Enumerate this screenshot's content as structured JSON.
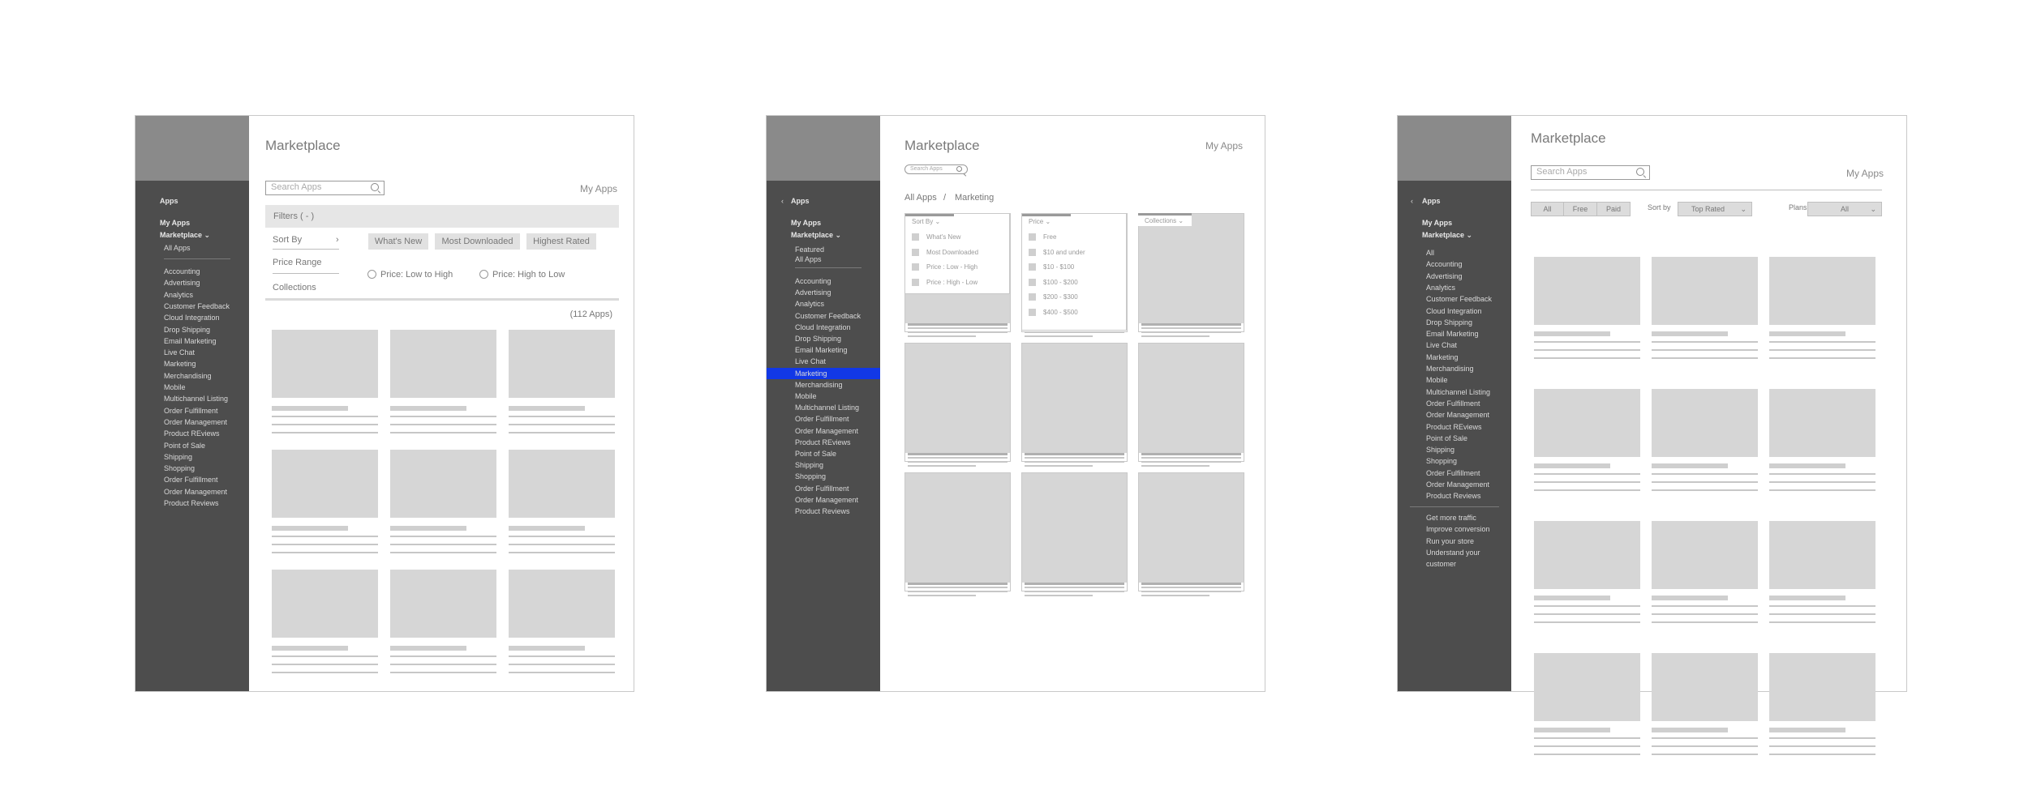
{
  "frame1": {
    "title": "Marketplace",
    "my_apps": "My Apps",
    "search_placeholder": "Search Apps",
    "filters_label": "Filters ( - )",
    "sort_by": "Sort By",
    "sort_chevron": "›",
    "price_range": "Price Range",
    "collections": "Collections",
    "chips": [
      "What's New",
      "Most Downloaded",
      "Highest Rated"
    ],
    "radios": [
      "Price: Low to High",
      "Price: High to Low"
    ],
    "count": "(112 Apps)",
    "sidebar": {
      "apps": "Apps",
      "my_apps": "My Apps",
      "marketplace": "Marketplace ⌄",
      "all_apps": "All Apps",
      "categories": [
        "Accounting",
        "Advertising",
        "Analytics",
        "Customer Feedback",
        "Cloud Integration",
        "Drop Shipping",
        "Email Marketing",
        "Live Chat",
        "Marketing",
        "Merchandising",
        "Mobile",
        "Multichannel Listing",
        "Order Fulfillment",
        "Order Management",
        "Product REviews",
        "Point of Sale",
        "Shipping",
        "Shopping",
        "Order Fulfillment",
        "Order Management",
        "Product Reviews"
      ]
    }
  },
  "frame2": {
    "title": "Marketplace",
    "my_apps": "My Apps",
    "search_placeholder": "Search Apps",
    "breadcrumb": [
      "All Apps",
      "/",
      "Marketing"
    ],
    "sort_dd": {
      "header": "Sort By  ⌄",
      "options": [
        "What's New",
        "Most Downloaded",
        "Price : Low - High",
        "Price : High - Low"
      ]
    },
    "price_dd": {
      "header": "Price  ⌄",
      "options": [
        "Free",
        "$10 and under",
        "$10 - $100",
        "$100 - $200",
        "$200 - $300",
        "$400 - $500"
      ]
    },
    "collections_dd": {
      "header": "Collections  ⌄"
    },
    "sidebar": {
      "back": "‹",
      "apps": "Apps",
      "my_apps": "My Apps",
      "marketplace": "Marketplace ⌄",
      "featured": "Featured",
      "all_apps": "All Apps",
      "categories": [
        "Accounting",
        "Advertising",
        "Analytics",
        "Customer Feedback",
        "Cloud Integration",
        "Drop Shipping",
        "Email Marketing",
        "Live Chat",
        "Marketing",
        "Merchandising",
        "Mobile",
        "Multichannel Listing",
        "Order Fulfillment",
        "Order Management",
        "Product REviews",
        "Point of Sale",
        "Shipping",
        "Shopping",
        "Order Fulfillment",
        "Order Management",
        "Product Reviews"
      ],
      "active": "Marketing"
    }
  },
  "frame3": {
    "title": "Marketplace",
    "my_apps": "My Apps",
    "search_placeholder": "Search Apps",
    "segments": [
      "All",
      "Free",
      "Paid"
    ],
    "sort_label": "Sort by",
    "sort_value": "Top Rated",
    "plans_label": "Plans",
    "plans_value": "All",
    "sidebar": {
      "back": "‹",
      "apps": "Apps",
      "my_apps": "My Apps",
      "marketplace": "Marketplace ⌄",
      "categories": [
        "All",
        "Accounting",
        "Advertising",
        "Analytics",
        "Customer Feedback",
        "Cloud Integration",
        "Drop Shipping",
        "Email Marketing",
        "Live Chat",
        "Marketing",
        "Merchandising",
        "Mobile",
        "Multichannel Listing",
        "Order Fulfillment",
        "Order Management",
        "Product REviews",
        "Point of Sale",
        "Shipping",
        "Shopping",
        "Order Fulfillment",
        "Order Management",
        "Product Reviews"
      ],
      "goals": [
        "Get more traffic",
        "Improve conversion",
        "Run your store",
        "Understand your",
        "customer"
      ]
    }
  }
}
